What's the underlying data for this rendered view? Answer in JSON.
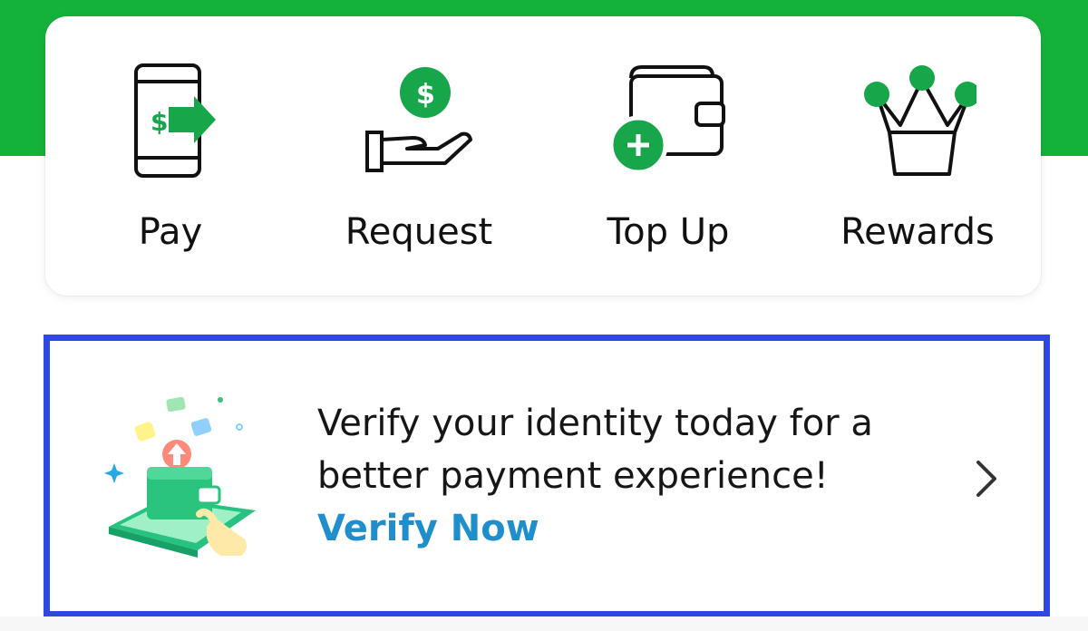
{
  "quick_actions": [
    {
      "id": "pay",
      "label": "Pay",
      "icon": "phone-send-money-icon"
    },
    {
      "id": "request",
      "label": "Request",
      "icon": "hand-receive-money-icon"
    },
    {
      "id": "top_up",
      "label": "Top Up",
      "icon": "wallet-add-icon"
    },
    {
      "id": "rewards",
      "label": "Rewards",
      "icon": "crown-icon"
    }
  ],
  "verify_banner": {
    "line1": "Verify your identity today for a",
    "line2": "better payment experience!",
    "cta": "Verify Now",
    "illustration": "identity-verification-illustration",
    "chevron_icon": "chevron-right-icon"
  },
  "colors": {
    "brand_green": "#15b23b",
    "icon_green": "#17a74a",
    "cta_blue": "#1e8fcc",
    "highlight_border": "#2f49e0",
    "text_dark": "#111111"
  }
}
